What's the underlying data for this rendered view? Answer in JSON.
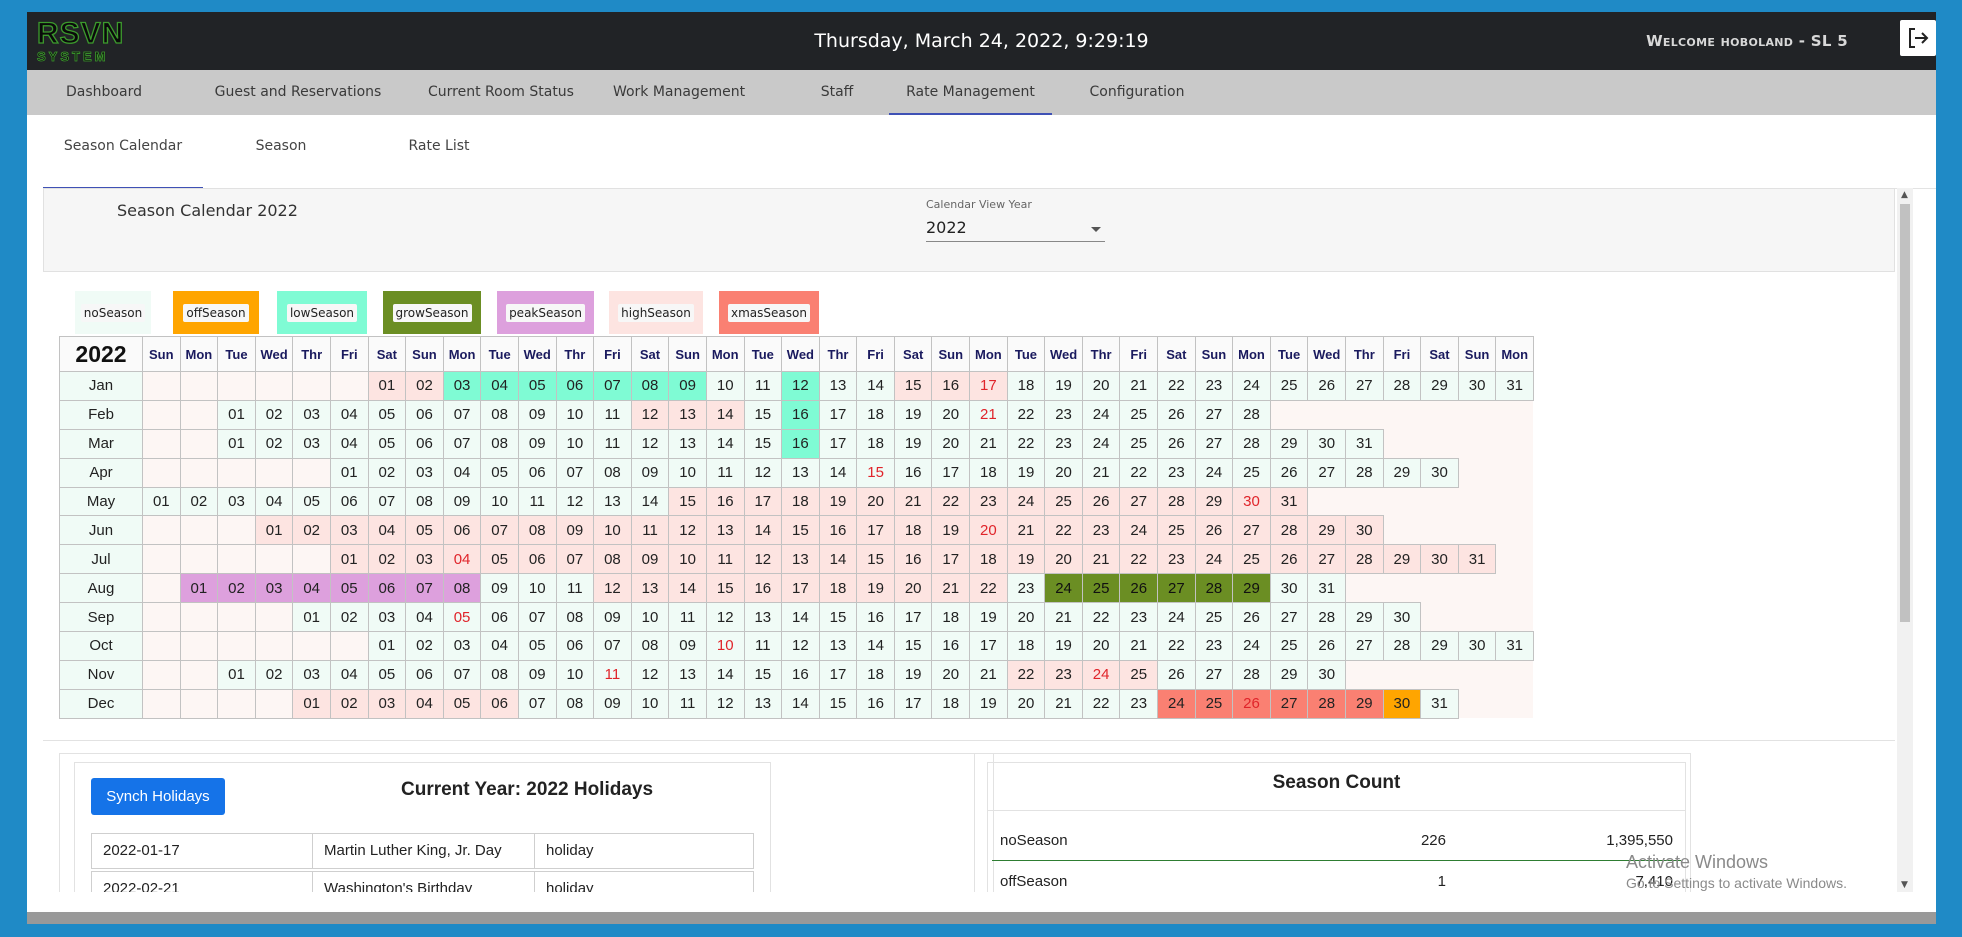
{
  "app": {
    "logo_line1": "RSVN",
    "logo_line2": "SYSTEM",
    "datetime": "Thursday, March 24, 2022, 9:29:19",
    "welcome": "Welcome hoboland - SL 5",
    "logout_icon": "logout-icon"
  },
  "nav": [
    {
      "label": "Dashboard"
    },
    {
      "label": "Guest and Reservations"
    },
    {
      "label": "Current Room Status"
    },
    {
      "label": "Work Management"
    },
    {
      "label": "Staff"
    },
    {
      "label": "Rate Management",
      "active": true
    },
    {
      "label": "Configuration"
    }
  ],
  "tabs": [
    {
      "label": "Season Calendar",
      "active": true
    },
    {
      "label": "Season"
    },
    {
      "label": "Rate List"
    }
  ],
  "header": {
    "title": "Season Calendar 2022",
    "year_label": "Calendar View Year",
    "year_value": "2022"
  },
  "legend": [
    {
      "label": "noSeason",
      "color": "#f0fbf6"
    },
    {
      "label": "offSeason",
      "color": "#ffa500"
    },
    {
      "label": "lowSeason",
      "color": "#7ffbd4"
    },
    {
      "label": "growSeason",
      "color": "#6b8e23"
    },
    {
      "label": "peakSeason",
      "color": "#dda0dd"
    },
    {
      "label": "highSeason",
      "color": "#fde4e1"
    },
    {
      "label": "xmasSeason",
      "color": "#fa8072"
    }
  ],
  "calendar": {
    "year": "2022",
    "weekday_headers": [
      "Sun",
      "Mon",
      "Tue",
      "Wed",
      "Thr",
      "Fri",
      "Sat",
      "Sun",
      "Mon",
      "Tue",
      "Wed",
      "Thr",
      "Fri",
      "Sat",
      "Sun",
      "Mon",
      "Tue",
      "Wed",
      "Thr",
      "Fri",
      "Sat",
      "Sun",
      "Mon",
      "Tue",
      "Wed",
      "Thr",
      "Fri",
      "Sat",
      "Sun",
      "Mon",
      "Tue",
      "Wed",
      "Thr",
      "Fri",
      "Sat",
      "Sun",
      "Mon"
    ],
    "months": [
      {
        "name": "Jan",
        "start": 6,
        "days": 31,
        "holidays": [
          17
        ],
        "seasons": {
          "1": "high",
          "2": "high",
          "3": "low",
          "4": "low",
          "5": "low",
          "6": "low",
          "7": "low",
          "8": "low",
          "9": "low",
          "12": "low",
          "15": "high",
          "16": "high",
          "17": "high"
        }
      },
      {
        "name": "Feb",
        "start": 2,
        "days": 28,
        "holidays": [
          21
        ],
        "seasons": {
          "12": "high",
          "13": "high",
          "14": "high",
          "16": "low"
        }
      },
      {
        "name": "Mar",
        "start": 2,
        "days": 31,
        "holidays": [],
        "seasons": {
          "16": "low"
        }
      },
      {
        "name": "Apr",
        "start": 5,
        "days": 30,
        "holidays": [
          15
        ],
        "seasons": {}
      },
      {
        "name": "May",
        "start": 0,
        "days": 31,
        "holidays": [
          30
        ],
        "seasons": {
          "15": "high",
          "16": "high",
          "17": "high",
          "18": "high",
          "19": "high",
          "20": "high",
          "21": "high",
          "22": "high",
          "23": "high",
          "24": "high",
          "25": "high",
          "26": "high",
          "27": "high",
          "28": "high",
          "29": "high",
          "30": "high",
          "31": "high"
        }
      },
      {
        "name": "Jun",
        "start": 3,
        "days": 30,
        "holidays": [
          20
        ],
        "seasons": {
          "1": "high",
          "2": "high",
          "3": "high",
          "4": "high",
          "5": "high",
          "6": "high",
          "7": "high",
          "8": "high",
          "9": "high",
          "10": "high",
          "11": "high",
          "12": "high",
          "13": "high",
          "14": "high",
          "15": "high",
          "16": "high",
          "17": "high",
          "18": "high",
          "19": "high",
          "20": "high",
          "21": "high",
          "22": "high",
          "23": "high",
          "24": "high",
          "25": "high",
          "26": "high",
          "27": "high",
          "28": "high",
          "29": "high",
          "30": "high"
        }
      },
      {
        "name": "Jul",
        "start": 5,
        "days": 31,
        "holidays": [
          4
        ],
        "seasons": {
          "1": "high",
          "2": "high",
          "3": "high",
          "4": "high",
          "5": "high",
          "6": "high",
          "7": "high",
          "8": "high",
          "9": "high",
          "10": "high",
          "11": "high",
          "12": "high",
          "13": "high",
          "14": "high",
          "15": "high",
          "16": "high",
          "17": "high",
          "18": "high",
          "19": "high",
          "20": "high",
          "21": "high",
          "22": "high",
          "23": "high",
          "24": "high",
          "25": "high",
          "26": "high",
          "27": "high",
          "28": "high",
          "29": "high",
          "30": "high",
          "31": "high"
        }
      },
      {
        "name": "Aug",
        "start": 1,
        "days": 31,
        "holidays": [],
        "seasons": {
          "1": "peak",
          "2": "peak",
          "3": "peak",
          "4": "peak",
          "5": "peak",
          "6": "peak",
          "7": "peak",
          "8": "peak",
          "12": "high",
          "13": "high",
          "14": "high",
          "15": "high",
          "16": "high",
          "17": "high",
          "18": "high",
          "19": "high",
          "20": "high",
          "21": "high",
          "22": "high",
          "24": "grow",
          "25": "grow",
          "26": "grow",
          "27": "grow",
          "28": "grow",
          "29": "grow"
        }
      },
      {
        "name": "Sep",
        "start": 4,
        "days": 30,
        "holidays": [
          5
        ],
        "seasons": {}
      },
      {
        "name": "Oct",
        "start": 6,
        "days": 31,
        "holidays": [
          10
        ],
        "seasons": {}
      },
      {
        "name": "Nov",
        "start": 2,
        "days": 30,
        "holidays": [
          11,
          24
        ],
        "seasons": {
          "22": "high",
          "23": "high",
          "24": "high",
          "25": "high"
        }
      },
      {
        "name": "Dec",
        "start": 4,
        "days": 31,
        "holidays": [
          26
        ],
        "seasons": {
          "1": "high",
          "2": "high",
          "3": "high",
          "4": "high",
          "5": "high",
          "6": "high",
          "24": "xmas",
          "25": "xmas",
          "26": "xmas",
          "27": "xmas",
          "28": "xmas",
          "29": "xmas",
          "30": "off"
        }
      }
    ]
  },
  "holidays_panel": {
    "synch_label": "Synch Holidays",
    "title": "Current Year: 2022 Holidays",
    "rows": [
      {
        "date": "2022-01-17",
        "name": "Martin Luther King, Jr. Day",
        "type": "holiday"
      },
      {
        "date": "2022-02-21",
        "name": "Washington's Birthday",
        "type": "holiday"
      }
    ]
  },
  "season_count": {
    "title": "Season Count",
    "rows": [
      {
        "season": "noSeason",
        "count": "226",
        "amount": "1,395,550"
      },
      {
        "season": "offSeason",
        "count": "1",
        "amount": "7,410"
      }
    ]
  },
  "watermark": {
    "line1": "Activate Windows",
    "line2": "Go to Settings to activate Windows."
  }
}
